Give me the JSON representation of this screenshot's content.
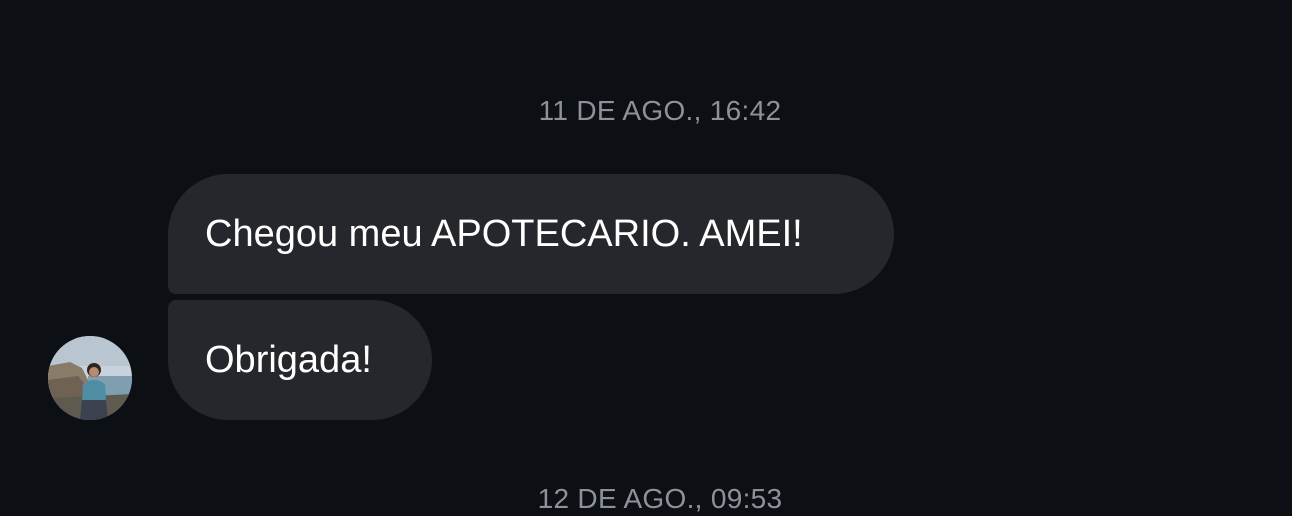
{
  "conversation": {
    "timestamps": [
      "11 DE AGO., 16:42",
      "12 DE AGO., 09:53"
    ],
    "messages": [
      {
        "text": "Chegou meu APOTECARIO. AMEI!"
      },
      {
        "text": "Obrigada!"
      }
    ],
    "avatar": {
      "icon": "user-photo-avatar"
    }
  },
  "colors": {
    "background": "#0c0f14",
    "bubble": "#25272c",
    "timestamp_text": "#8e9199",
    "message_text": "#ffffff"
  }
}
